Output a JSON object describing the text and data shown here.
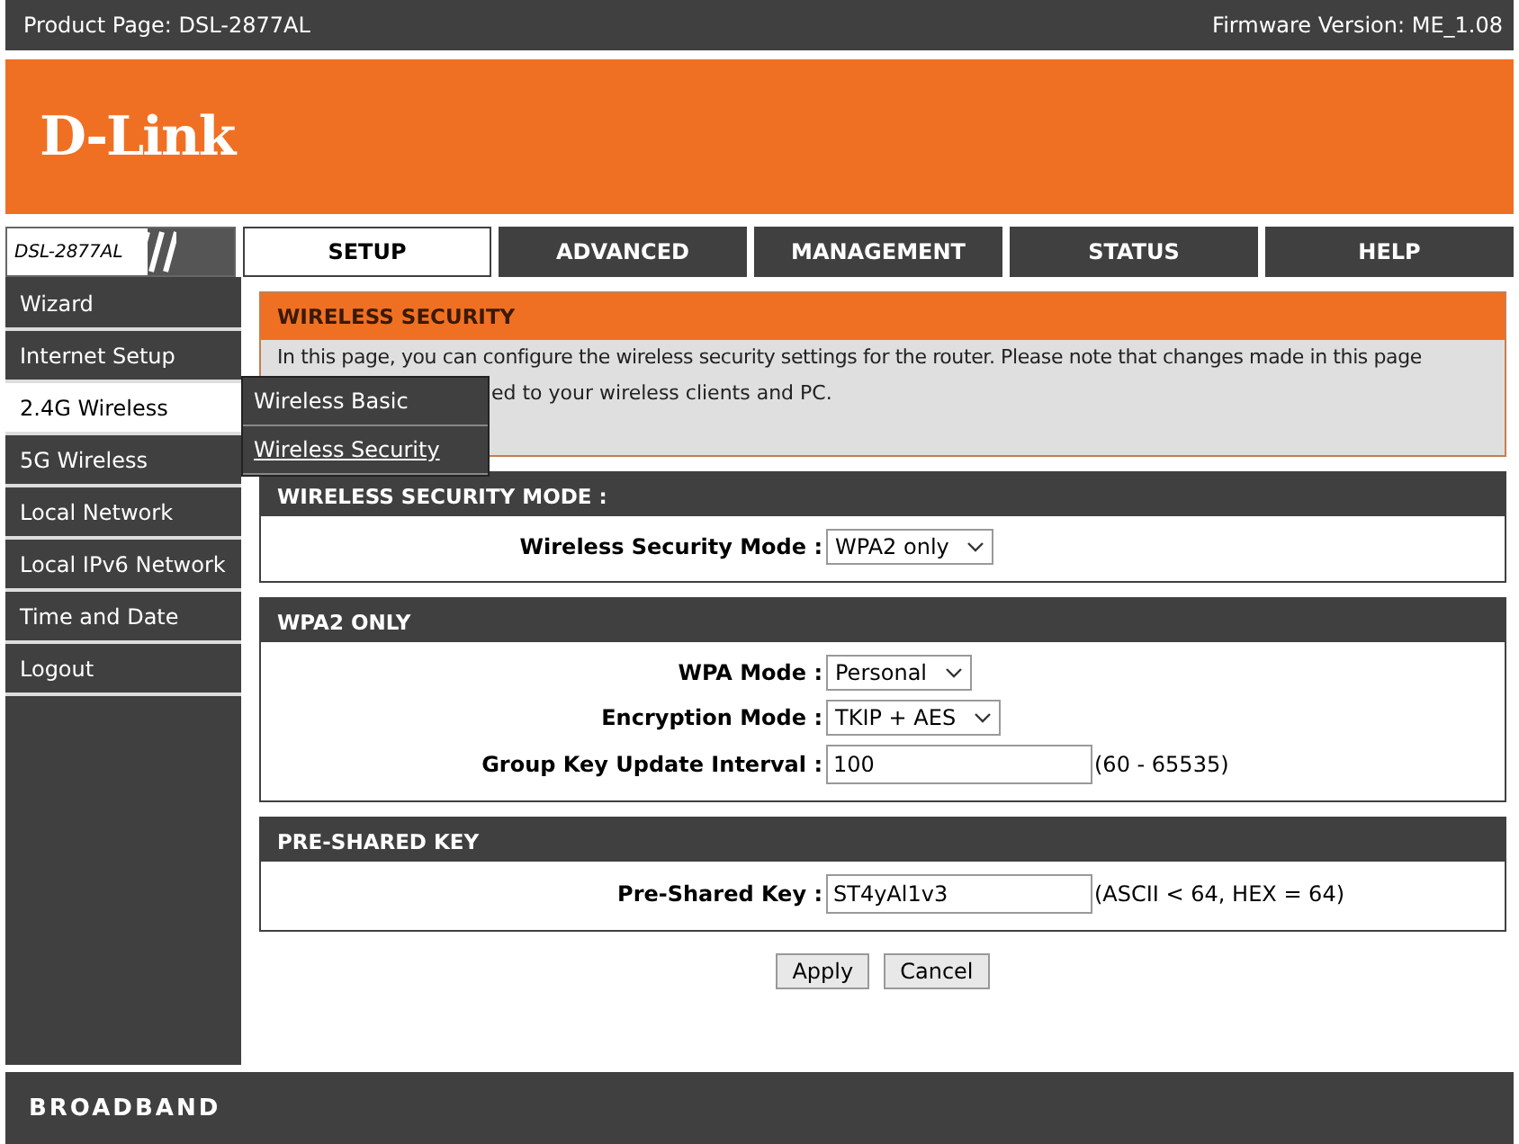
{
  "top_bar": {
    "product": "Product Page: DSL-2877AL",
    "firmware": "Firmware Version: ME_1.08"
  },
  "brand": {
    "logo": "D-Link"
  },
  "model_label": "DSL-2877AL",
  "tabs": [
    {
      "label": "SETUP",
      "selected": true
    },
    {
      "label": "ADVANCED",
      "selected": false
    },
    {
      "label": "MANAGEMENT",
      "selected": false
    },
    {
      "label": "STATUS",
      "selected": false
    },
    {
      "label": "HELP",
      "selected": false
    }
  ],
  "sidebar": {
    "items": [
      {
        "label": "Wizard",
        "selected": false
      },
      {
        "label": "Internet Setup",
        "selected": false
      },
      {
        "label": "2.4G Wireless",
        "selected": true
      },
      {
        "label": "5G Wireless",
        "selected": false
      },
      {
        "label": "Local Network",
        "selected": false
      },
      {
        "label": "Local IPv6 Network",
        "selected": false
      },
      {
        "label": "Time and Date",
        "selected": false
      },
      {
        "label": "Logout",
        "selected": false
      }
    ]
  },
  "submenu": {
    "items": [
      {
        "label": "Wireless Basic",
        "selected": false
      },
      {
        "label": "Wireless Security",
        "selected": true
      }
    ]
  },
  "intro": {
    "title": "WIRELESS SECURITY",
    "line_1": "In this page, you can configure the wireless security settings for the router. Please note that changes made in this page",
    "line_2": "ed to your wireless clients and PC."
  },
  "sections": [
    {
      "title": "WIRELESS SECURITY MODE :",
      "fields": [
        {
          "kind": "select",
          "label": "Wireless Security Mode :",
          "value": "WPA2 only"
        }
      ]
    },
    {
      "title": "WPA2 ONLY",
      "fields": [
        {
          "kind": "select",
          "label": "WPA Mode :",
          "value": "Personal"
        },
        {
          "kind": "select",
          "label": "Encryption Mode :",
          "value": "TKIP + AES"
        },
        {
          "kind": "text",
          "label": "Group Key Update Interval :",
          "value": "100",
          "hint": "(60 - 65535)"
        }
      ]
    },
    {
      "title": "PRE-SHARED KEY",
      "fields": [
        {
          "kind": "text",
          "label": "Pre-Shared Key :",
          "value": "ST4yAl1v3",
          "hint": "(ASCII < 64, HEX = 64)"
        }
      ]
    }
  ],
  "buttons": [
    "Apply",
    "Cancel"
  ],
  "footer": "BROADBAND"
}
